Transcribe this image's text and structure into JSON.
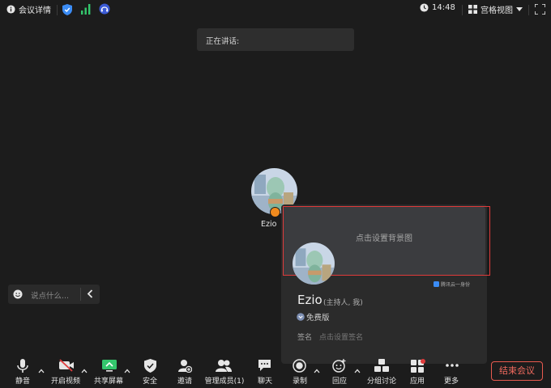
{
  "topbar": {
    "meeting_info": "会议详情",
    "time": "14:48",
    "view_mode": "宫格视图"
  },
  "speaking": {
    "label": "正在讲话:"
  },
  "participant": {
    "name": "Ezio"
  },
  "chat": {
    "placeholder": "说点什么..."
  },
  "profile_card": {
    "background_hint": "点击设置背景图",
    "brand": "腾讯云一身份",
    "name": "Ezio",
    "role": "(主持人, 我)",
    "plan": "免费版",
    "signature_label": "签名",
    "signature_placeholder": "点击设置签名"
  },
  "toolbar": {
    "mute": "静音",
    "video": "开启视频",
    "share": "共享屏幕",
    "security": "安全",
    "invite": "邀请",
    "members": "管理成员(1)",
    "chat": "聊天",
    "record": "录制",
    "reaction": "回应",
    "breakout": "分组讨论",
    "apps": "应用",
    "more": "更多",
    "end": "结束会议"
  },
  "colors": {
    "accent_red": "#e03b3b",
    "host_badge": "#f08a1e",
    "shield_blue": "#3b8cf5",
    "signal_green": "#34c76d"
  }
}
